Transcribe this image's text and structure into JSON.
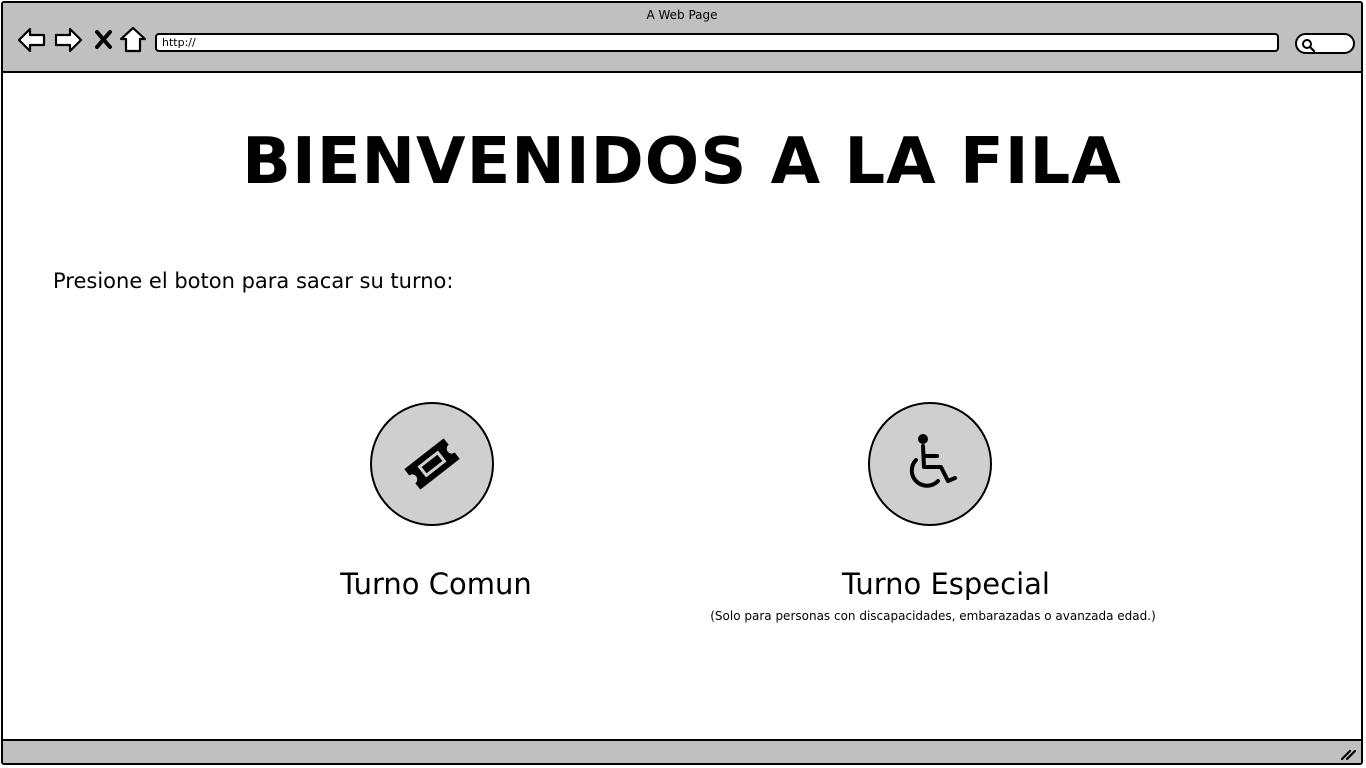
{
  "window": {
    "title": "A Web Page"
  },
  "toolbar": {
    "back_icon": "back-arrow-icon",
    "forward_icon": "forward-arrow-icon",
    "stop_icon": "close-icon",
    "home_icon": "home-icon",
    "address_value": "http://",
    "search_icon": "search-icon"
  },
  "main": {
    "heading": "BIENVENIDOS A LA FILA",
    "instruction": "Presione el boton para sacar su turno:",
    "buttons": [
      {
        "label": "Turno Comun",
        "icon": "ticket-icon"
      },
      {
        "label": "Turno Especial",
        "icon": "wheelchair-icon",
        "note": "(Solo para personas con discapacidades, embarazadas o avanzada edad.)"
      }
    ]
  },
  "colors": {
    "chrome": "#c0c0c0",
    "button_fill": "#cfcfcf",
    "border": "#000000"
  }
}
